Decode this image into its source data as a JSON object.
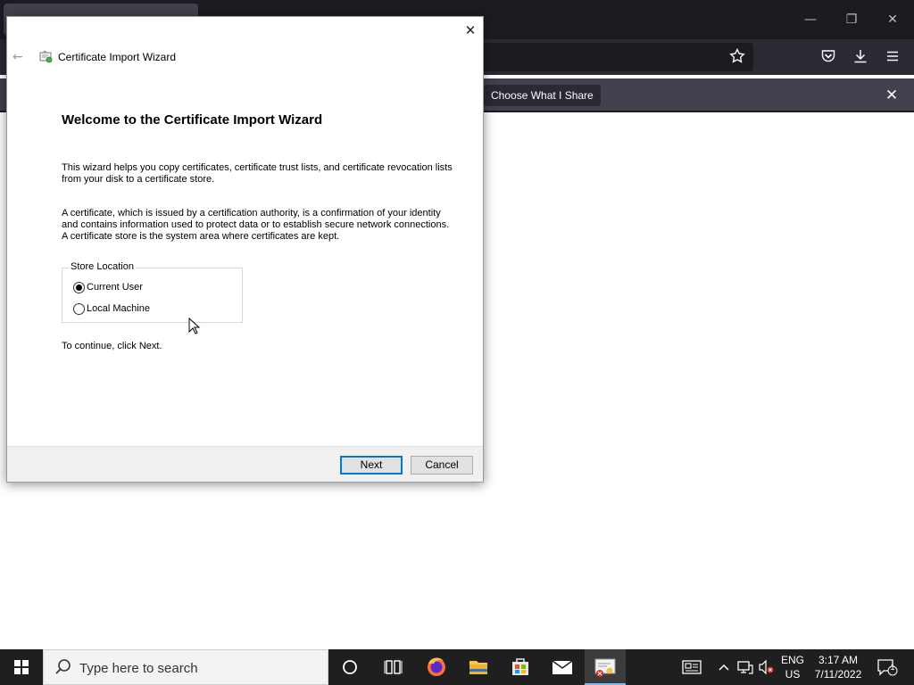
{
  "browser": {
    "window_controls": {
      "minimize": "—",
      "restore": "❐",
      "close": "✕"
    },
    "sharing_bar": {
      "choose_label": "Choose What I Share",
      "close_glyph": "✕"
    }
  },
  "wizard": {
    "title": "Certificate Import Wizard",
    "close_glyph": "✕",
    "back_glyph": "←",
    "heading": "Welcome to the Certificate Import Wizard",
    "intro": "This wizard helps you copy certificates, certificate trust lists, and certificate revocation lists from your disk to a certificate store.",
    "description": "A certificate, which is issued by a certification authority, is a confirmation of your identity and contains information used to protect data or to establish secure network connections. A certificate store is the system area where certificates are kept.",
    "store_location": {
      "legend": "Store Location",
      "options": [
        {
          "label": "Current User",
          "selected": true
        },
        {
          "label": "Local Machine",
          "selected": false
        }
      ]
    },
    "continue_text": "To continue, click Next.",
    "next_label": "Next",
    "cancel_label": "Cancel"
  },
  "taskbar": {
    "search_placeholder": "Type here to search",
    "language": {
      "line1": "ENG",
      "line2": "US"
    },
    "clock": {
      "time": "3:17 AM",
      "date": "7/11/2022"
    },
    "notification_count": "1"
  },
  "colors": {
    "accent": "#0078d7",
    "taskbar_bg": "#1f1f1f",
    "browser_bg": "#2b2a33"
  }
}
